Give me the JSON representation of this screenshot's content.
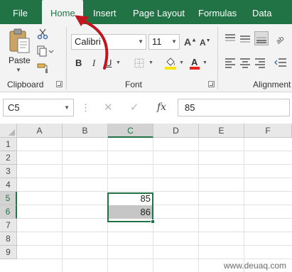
{
  "ribbon_tabs": [
    {
      "label": "File"
    },
    {
      "label": "Home"
    },
    {
      "label": "Insert"
    },
    {
      "label": "Page Layout"
    },
    {
      "label": "Formulas"
    },
    {
      "label": "Data"
    }
  ],
  "clipboard": {
    "paste_label": "Paste",
    "group_label": "Clipboard"
  },
  "font": {
    "name": "Calibri",
    "size": "11",
    "group_label": "Font"
  },
  "alignment": {
    "group_label": "Alignment"
  },
  "formula_bar": {
    "name_box": "C5",
    "cancel_glyph": "✕",
    "enter_glyph": "✓",
    "fx_label": "fx",
    "value": "85"
  },
  "grid": {
    "columns": [
      "A",
      "B",
      "C",
      "D",
      "E",
      "F"
    ],
    "rows": [
      "1",
      "2",
      "3",
      "4",
      "5",
      "6",
      "7",
      "8",
      "9"
    ],
    "selected_column": "C",
    "selected_rows": [
      "5",
      "6"
    ],
    "cells": {
      "C5": "85",
      "C6": "86"
    }
  },
  "watermark": "www.deuaq.com",
  "colors": {
    "accent": "#217346",
    "arrow": "#c0161e",
    "highlight": "#f5e600",
    "font_color": "#e8231b"
  },
  "icons": [
    "paste-icon",
    "cut-icon",
    "copy-icon",
    "format-painter-icon",
    "bold-icon",
    "italic-icon",
    "underline-icon",
    "borders-icon",
    "fill-color-icon",
    "font-color-icon",
    "increase-font-icon",
    "decrease-font-icon",
    "align-top-icon",
    "align-middle-icon"
  ]
}
